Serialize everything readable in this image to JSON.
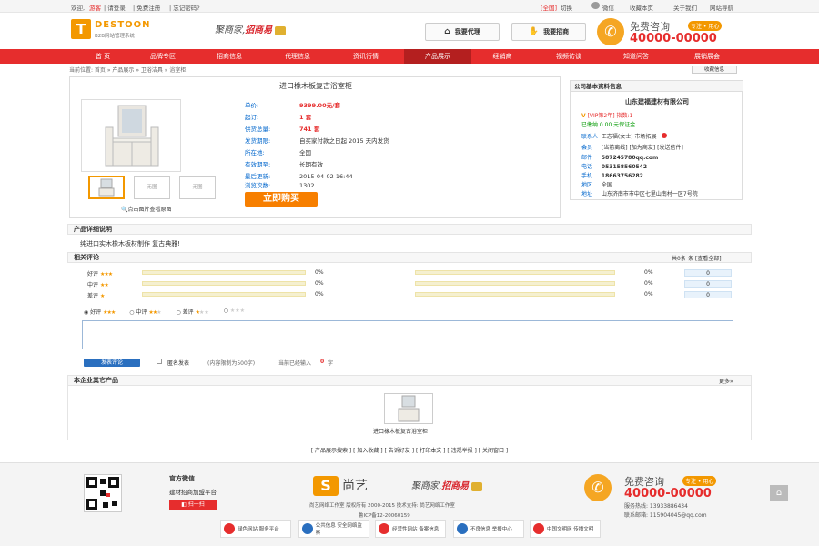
{
  "topbar": {
    "welcome": "欢迎,",
    "user": "游客",
    "login": "| 请登录",
    "register": "| 免费注册",
    "forgot": "| 忘记密码?",
    "region": "[全国]",
    "switch": "切换",
    "wechat": "微信",
    "bookmark": "收藏本页",
    "about": "关于我们",
    "sitemap": "网站导航"
  },
  "header": {
    "logo_letter": "T",
    "logo_name": "DESTOON",
    "logo_sub": "B2B网站管理系统",
    "slogan_a": "聚商家,",
    "slogan_b": "招商易",
    "btn_agent": "我要代理",
    "btn_invest": "我要招商",
    "consult_label": "免费咨询",
    "consult_tag": "专注 • 用心",
    "consult_phone": "40000-00000"
  },
  "nav": [
    "首 页",
    "品牌专区",
    "招商信息",
    "代理信息",
    "资讯行情",
    "产品展示",
    "经销商",
    "视频访谈",
    "知道问答",
    "展销展会"
  ],
  "breadcrumb": "当前位置: 首页 » 产品展示 » 卫浴洁具 » 浴室柜",
  "favorite": "收藏信息",
  "product": {
    "title": "进口橡木板复古浴室柜",
    "labels": [
      "单价:",
      "起订:",
      "供货总量:",
      "发货期限:",
      "所在地:",
      "有效期至:",
      "最后更新:",
      "浏览次数:"
    ],
    "values": [
      "9399.00元/套",
      "1 套",
      "741 套",
      "自买家付款之日起 2015 天内发货",
      "全国",
      "长期有效",
      "2015-04-02 16:44",
      "1302"
    ],
    "thumb_none": "无图",
    "view_big": "点击图片查看原图",
    "buy": "立即购买"
  },
  "company": {
    "head": "公司基本资料信息",
    "name": "山东建福建材有限公司",
    "vip": "[VIP第2年] 指数:1",
    "deposit": "已缴纳 0.00 元保证金",
    "contact_k": "联系人",
    "contact_v": "王志福(女士) 市场拓展",
    "member_k": "会员",
    "member_v": "[当前离线] [加为商友] [发送信件]",
    "email_k": "邮件",
    "email_v": "587245780qq.com",
    "tel_k": "电话",
    "tel_v": "053158560542",
    "mobile_k": "手机",
    "mobile_v": "18663756282",
    "area_k": "地区",
    "area_v": "全国",
    "addr_k": "地址",
    "addr_v": "山东济南市市中区七里山南村一区7号院"
  },
  "detail": {
    "head": "产品详细说明",
    "text": "纯进口实木橡木板材制作 复古典雅!"
  },
  "reviews": {
    "head": "相关评论",
    "total": "共0条",
    "view_all": "条 [查看全部]",
    "rows": [
      {
        "label": "好评",
        "pct": "0%",
        "pct2": "0%",
        "count": "0"
      },
      {
        "label": "中评",
        "pct": "0%",
        "pct2": "0%",
        "count": "0"
      },
      {
        "label": "差评",
        "pct": "0%",
        "pct2": "0%",
        "count": "0"
      }
    ],
    "radio_good": "好评",
    "radio_mid": "中评",
    "radio_bad": "差评",
    "submit": "发表评论",
    "anon": "匿名发表",
    "limit": "(内容限制为500字)",
    "typed": "当前已经输入",
    "typed_count": "0",
    "typed_unit": "字"
  },
  "others": {
    "head": "本企业其它产品",
    "more": "更多»",
    "item": "进口橡木板复古浴室柜"
  },
  "tools": "[ 产品展示搜索 ] [ 加入收藏 ] [ 告诉好友 ] [ 打印本文 ] [ 违规举报 ] [ 关闭窗口 ]",
  "footer": {
    "wx_title": "官方微信",
    "wx_desc": "建材招商加盟平台",
    "wx_scan": "扫一扫",
    "logo_s": "S",
    "logo_name": "尚艺",
    "slogan_a": "聚商家,",
    "slogan_b": "招商易",
    "copyright": "尚艺网络工作室 版权所有 2000-2015 技术支持: 尚艺网络工作室",
    "icp": "鲁ICP备12-20060159",
    "consult_label": "免费咨询",
    "consult_tag": "专注 • 用心",
    "consult_phone": "40000-00000",
    "service_phone": "服务热线: 13933886434",
    "service_email": "联系邮箱: 115904045@qq.com",
    "badges": [
      "绿色网站 服务平台",
      "公共信息 安全网络监察",
      "经营性网站 备案信息",
      "不良信息 举报中心",
      "中国文明网 传播文明"
    ]
  },
  "colors": {
    "brand_red": "#e62d2d",
    "orange": "#f39800",
    "link_blue": "#0066cc"
  }
}
